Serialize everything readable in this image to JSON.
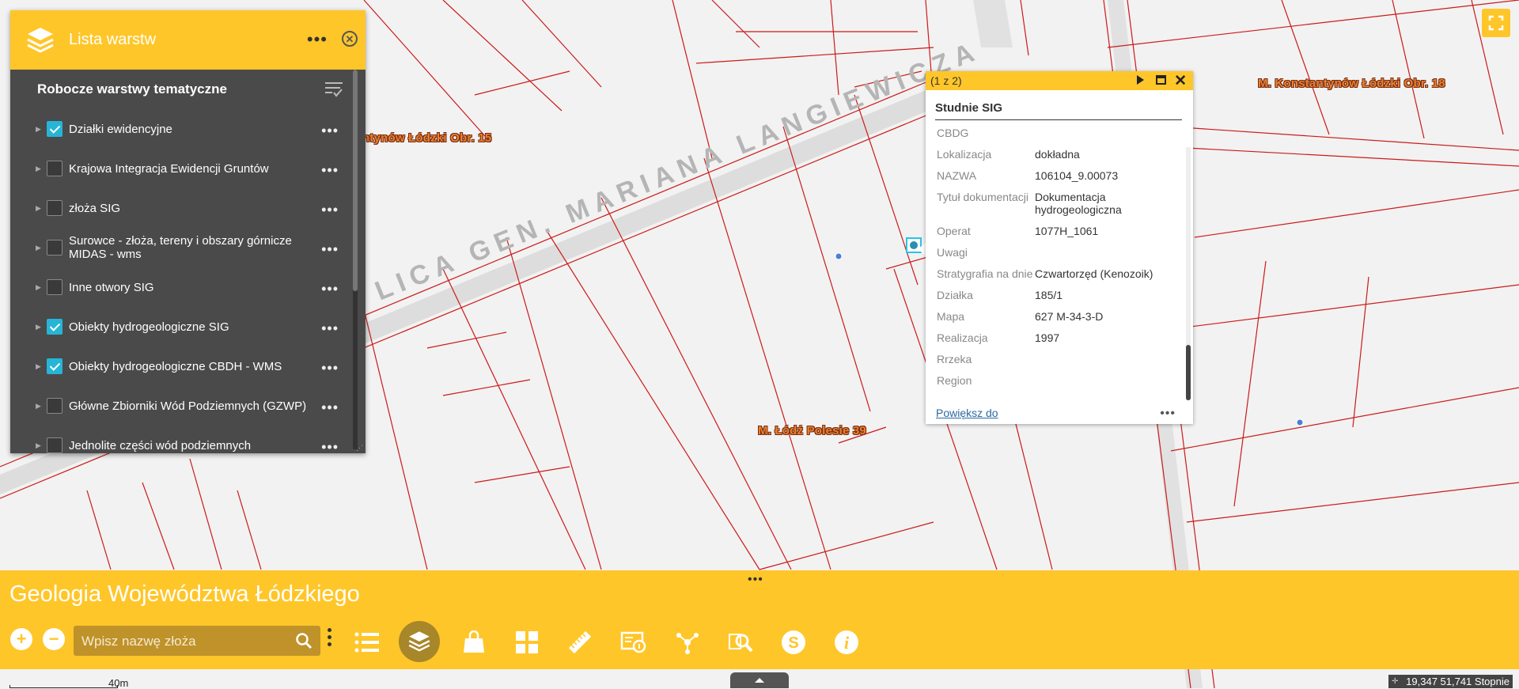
{
  "map": {
    "labels": [
      "ntynów Łódzki Obr. 15",
      "M. Konstantynów Łódzki Obr. 18",
      "M. Łódź Polesie 39"
    ],
    "street_text": "LICA GEN. MARIANA LANGIEWICZA"
  },
  "layer_panel": {
    "title": "Lista warstw",
    "section_title": "Robocze warstwy tematyczne",
    "layers": [
      {
        "label": "Działki ewidencyjne",
        "checked": true
      },
      {
        "label": "Krajowa Integracja Ewidencji Gruntów",
        "checked": false
      },
      {
        "label": "złoża SIG",
        "checked": false
      },
      {
        "label": "Surowce - złoża, tereny i obszary górnicze MIDAS - wms",
        "checked": false
      },
      {
        "label": "Inne otwory SIG",
        "checked": false
      },
      {
        "label": "Obiekty hydrogeologiczne SIG",
        "checked": true
      },
      {
        "label": "Obiekty hydrogeologiczne CBDH - WMS",
        "checked": true
      },
      {
        "label": "Główne Zbiorniki Wód Podziemnych (GZWP)",
        "checked": false
      },
      {
        "label": "Jednolite części wód podziemnych",
        "checked": false
      }
    ]
  },
  "popup": {
    "count": "(1 z 2)",
    "title": "Studnie SIG",
    "attributes": [
      {
        "key": "CBDG",
        "value": ""
      },
      {
        "key": "Lokalizacja",
        "value": "dokładna"
      },
      {
        "key": "NAZWA",
        "value": "106104_9.00073"
      },
      {
        "key": "Tytuł dokumentacji",
        "value": "Dokumentacja hydrogeologiczna"
      },
      {
        "key": "Operat",
        "value": "1077H_1061"
      },
      {
        "key": "Uwagi",
        "value": ""
      },
      {
        "key": "Stratygrafia na dnie",
        "value": "Czwartorzęd (Kenozoik)"
      },
      {
        "key": "Działka",
        "value": "185/1"
      },
      {
        "key": "Mapa",
        "value": "627 M-34-3-D"
      },
      {
        "key": "Realizacja",
        "value": "1997"
      },
      {
        "key": "Rrzeka",
        "value": ""
      },
      {
        "key": "Region",
        "value": ""
      }
    ],
    "zoom_link": "Powiększ do"
  },
  "bottom_bar": {
    "title": "Geologia Województwa Łódzkiego",
    "search_placeholder": "Wpisz nazwę złoża",
    "zoom_in": "+",
    "zoom_out": "−",
    "tools": [
      "legend-list-icon",
      "layers-icon",
      "basemap-bag-icon",
      "grid-icon",
      "measure-ruler-icon",
      "map-info-icon",
      "network-icon",
      "search-zoom-icon",
      "s-circle-icon",
      "info-circle-icon"
    ]
  },
  "status": {
    "scale_label": "40m",
    "coordinates": "19,347 51,741 Stopnie"
  },
  "colors": {
    "accent": "#ffc629",
    "parcel_lines": "#cc1a1a",
    "panel_bg": "#4a4a4a",
    "checkbox": "#26b5d6"
  }
}
